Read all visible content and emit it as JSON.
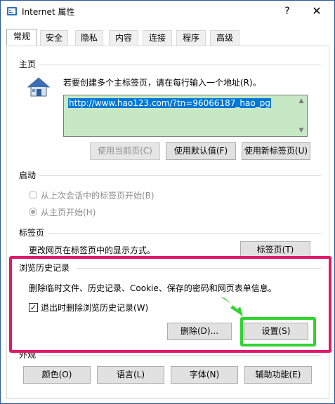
{
  "titlebar": {
    "title": "Internet 属性",
    "help": "?",
    "close": "✕"
  },
  "tabs": [
    {
      "label": "常规",
      "active": true
    },
    {
      "label": "安全"
    },
    {
      "label": "隐私"
    },
    {
      "label": "内容"
    },
    {
      "label": "连接"
    },
    {
      "label": "程序"
    },
    {
      "label": "高级"
    }
  ],
  "homepage": {
    "group_title": "主页",
    "description": "若要创建多个主标签页，请在每行输入一个地址(R)。",
    "url_value": "http://www.hao123.com/?tn=96066187_hao_pg",
    "buttons": {
      "use_current": "使用当前页(C)",
      "use_default": "使用默认值(F)",
      "use_new_tab": "使用新标签页(U)"
    }
  },
  "startup": {
    "group_title": "启动",
    "option_last_session": "从上次会话中的标签页开始(B)",
    "option_homepage": "从主页开始(H)"
  },
  "tabs_section": {
    "group_title": "标签页",
    "description": "更改网页在标签页中的显示方式。",
    "button": "标签页(T)"
  },
  "history": {
    "group_title": "浏览历史记录",
    "description": "删除临时文件、历史记录、Cookie、保存的密码和网页表单信息。",
    "checkbox_label": "退出时删除浏览历史记录(W)",
    "checkbox_checked": true,
    "delete_button": "删除(D)...",
    "settings_button": "设置(S)"
  },
  "appearance": {
    "group_title": "外观",
    "buttons": {
      "colors": "颜色(O)",
      "languages": "语言(L)",
      "fonts": "字体(N)",
      "accessibility": "辅助功能(E)"
    }
  },
  "colors": {
    "highlight_border": "#e0196a",
    "green_border": "#31d331",
    "url_bg": "#c7e8c5",
    "selection": "#0078d7"
  }
}
